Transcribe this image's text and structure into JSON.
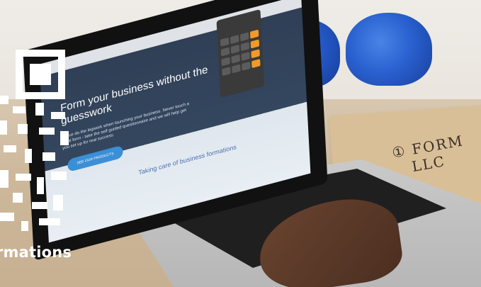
{
  "photo": {
    "screen": {
      "headline": "Form your business without the guesswork",
      "subtext": "Let us do the legwork when launching your business. Never touch a legal form - take the self guided questionnaire and we will help get you set up for real success.",
      "cta_label": "SEE OUR PRODUCTS",
      "footer_text": "Taking care of business formations"
    },
    "note_paper": {
      "line1": "① FORM",
      "line2": "LLC"
    }
  },
  "overlay": {
    "brand_word": "rmations"
  }
}
